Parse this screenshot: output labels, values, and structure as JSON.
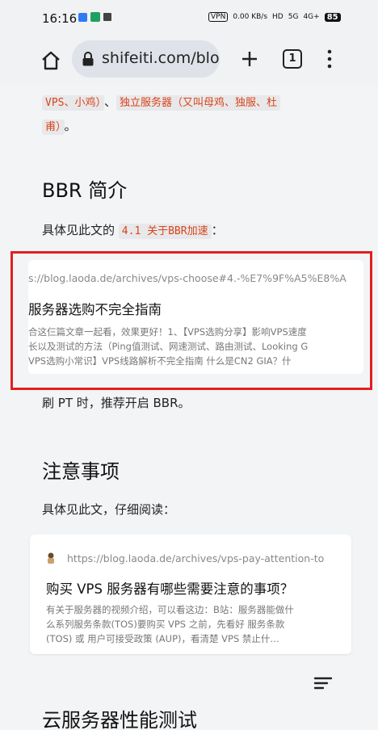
{
  "status_bar": {
    "time": "16:16",
    "vpn": "VPN",
    "net_speed": "0.00 KB/s",
    "hd": "HD",
    "signal1": "5G",
    "signal2": "4G+",
    "battery": "85"
  },
  "browser": {
    "url": "shifeiti.com/blog",
    "tab_count": "1"
  },
  "article": {
    "intro_parts": [
      "VPS、小鸡）",
      "、",
      "独立服务器（又叫母鸡、独服、杜",
      "甫）",
      "。"
    ],
    "section1_title": "BBR 简介",
    "section1_text_before": "具体见此文的",
    "section1_code": "4.1 关于BBR加速",
    "section1_text_after": "：",
    "card1": {
      "url": "s://blog.laoda.de/archives/vps-choose#4.-%E7%9F%A5%E8%A",
      "title": "服务器选购不完全指南",
      "desc_lines": [
        "合这仨篇文章一起看，效果更好！1、【VPS选购分享】影响VPS速度",
        "长以及测试的方法（Ping值测试、网速测试、路由测试、Looking G",
        "VPS选购小常识】VPS线路解析不完全指南 什么是CN2 GIA？什"
      ]
    },
    "bbr_note": "刷 PT 时，推荐开启 BBR。",
    "section2_title": "注意事项",
    "section2_text": "具体见此文，仔细阅读：",
    "card2": {
      "url": "https://blog.laoda.de/archives/vps-pay-attention-to",
      "title": "购买 VPS 服务器有哪些需要注意的事项？",
      "desc_lines": [
        "有关于服务器的视频介绍，可以看这边：B站：服务器能做什",
        "么系列服务条款(TOS)要购买 VPS 之前，先看好 服务条款",
        "(TOS) 或 用户可接受政策 (AUP)，看清楚 VPS 禁止什…"
      ]
    },
    "section3_title": "云服务器性能测试"
  },
  "colors": {
    "accent_code": "#d9441a",
    "highlight_box": "#e0201f"
  }
}
